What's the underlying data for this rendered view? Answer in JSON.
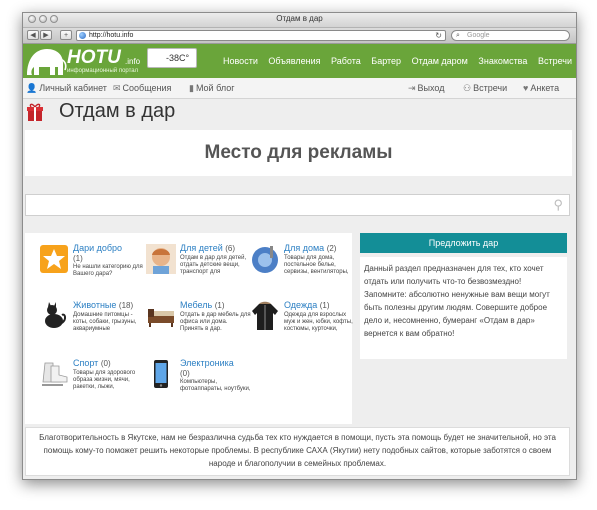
{
  "window": {
    "title": "Отдам в дар",
    "url": "http://hotu.info",
    "search_placeholder": "Google"
  },
  "site": {
    "logo_text": "HOTU",
    "logo_suffix": ".info",
    "logo_tagline": "информационный портал",
    "weather_temp": "-38C°",
    "nav": [
      "Новости",
      "Объявления",
      "Работа",
      "Бартер",
      "Отдам даром",
      "Знакомства",
      "Встречи"
    ]
  },
  "subnav": {
    "left": [
      "Личный кабинет",
      "Сообщения",
      "Мой блог"
    ],
    "right": [
      "Выход",
      "Встречи",
      "Анкета"
    ]
  },
  "page": {
    "title": "Отдам в дар",
    "ad_text": "Место для рекламы"
  },
  "categories": [
    {
      "title": "Дари добро",
      "count": "(1)",
      "desc": "Не нашли категорию для Вашего дара?"
    },
    {
      "title": "Для детей",
      "count": "(6)",
      "desc": "Отдам в дар для детей, отдать детские вещи, транспорт для"
    },
    {
      "title": "Для дома",
      "count": "(2)",
      "desc": "Товары для дома, постельное белье, сервизы, вентиляторы,"
    },
    {
      "title": "Животные",
      "count": "(18)",
      "desc": "Домашние питомцы - коты, собаки, грызуны, аквариумные"
    },
    {
      "title": "Мебель",
      "count": "(1)",
      "desc": "Отдать в дар мебель для офиса или дома. Принять в дар."
    },
    {
      "title": "Одежда",
      "count": "(1)",
      "desc": "Одежда для взрослых муж и жен, юбки, кофты, костюмы, курточки,"
    },
    {
      "title": "Спорт",
      "count": "(0)",
      "desc": "Товары для здорового образа жизни, мячи, ракетки, лыжи,"
    },
    {
      "title": "Электроника",
      "count": "(0)",
      "desc": "Компьютеры, фотоаппараты, ноутбуки,"
    }
  ],
  "right_panel": {
    "button": "Предложить дар",
    "info": "Данный раздел предназначен для тех, кто хочет отдать или получить что-то безвозмездно! Запомните: абсолютно ненужные вам вещи могут быть полезны другим людям. Совершите доброе дело и, несомненно, бумеранг «Отдам в дар» вернется к вам обратно!"
  },
  "footer": {
    "text": "Благотворительность в Якутске, нам не безразлична судьба тех кто нуждается в помощи, пусть эта помощь будет не значительной, но эта помощь кому-то поможет решить некоторые проблемы. В республике САХА (Якутии) нету подобных сайтов, которые заботятся о своем народе и благополучии в семейных проблемах."
  },
  "colors": {
    "header_green": "#6aa53a",
    "button_teal": "#138e97",
    "link_blue": "#2b7fc3"
  }
}
